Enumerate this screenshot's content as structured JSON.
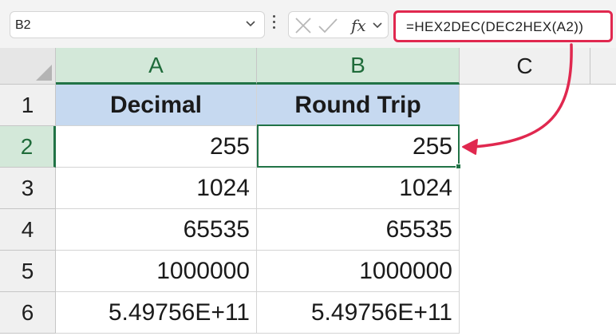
{
  "formula_bar": {
    "name_box": "B2",
    "fx_label": "fx",
    "formula": "=HEX2DEC(DEC2HEX(A2))"
  },
  "columns": [
    "A",
    "B",
    "C"
  ],
  "rows": [
    "1",
    "2",
    "3",
    "4",
    "5",
    "6"
  ],
  "cells": {
    "A1": "Decimal",
    "B1": "Round Trip",
    "A2": "255",
    "B2": "255",
    "A3": "1024",
    "B3": "1024",
    "A4": "65535",
    "B4": "65535",
    "A5": "1000000",
    "B5": "1000000",
    "A6": "5.49756E+11",
    "B6": "5.49756E+11"
  },
  "colors": {
    "accent_red": "#e0284f",
    "selection_green": "#217346",
    "header_fill": "#c6d9f0"
  },
  "icons": [
    "chevron-down-icon",
    "more-options-icon",
    "cancel-icon",
    "enter-icon",
    "chevron-down-icon",
    "select-all-icon",
    "curved-arrow"
  ]
}
